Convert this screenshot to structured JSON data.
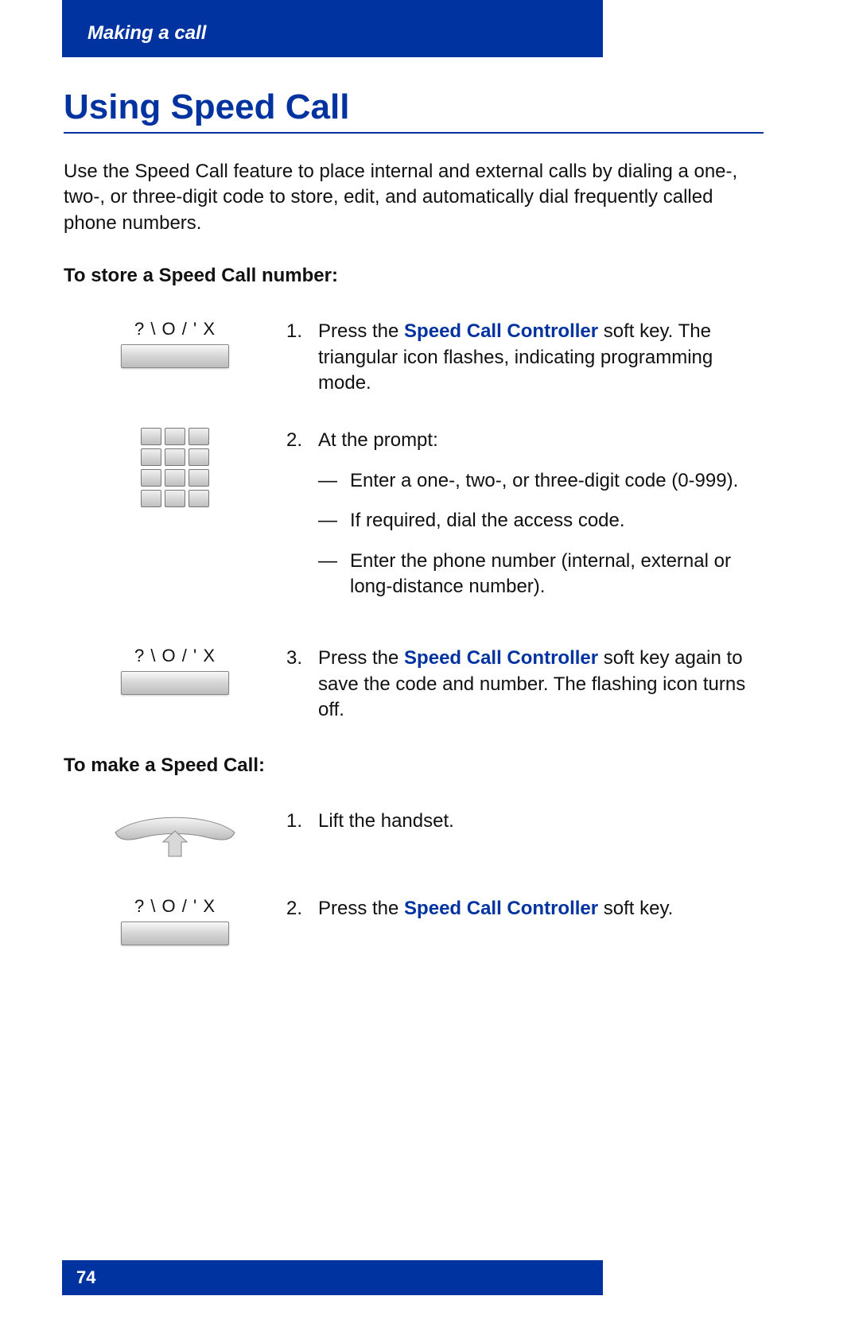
{
  "header": {
    "section": "Making a call"
  },
  "title": "Using Speed Call",
  "intro": "Use the Speed Call feature to place internal and external calls by dialing a one-, two-, or three-digit code to store, edit, and automatically dial frequently called phone numbers.",
  "section1": {
    "heading": "To store a Speed Call number:",
    "steps": {
      "s1": {
        "icon_label": "? \\ O / ' X",
        "num": "1.",
        "prefix": "Press the ",
        "bold": "Speed Call Controller",
        "suffix": " soft key. The triangular icon flashes, indicating programming mode."
      },
      "s2": {
        "num": "2.",
        "lead": "At the prompt:",
        "a": "Enter a one-, two-, or three-digit code (0-999).",
        "b": "If required, dial the access code.",
        "c": "Enter the phone number (internal, external or long-distance number)."
      },
      "s3": {
        "icon_label": "? \\ O / ' X",
        "num": "3.",
        "prefix": "Press the ",
        "bold": "Speed Call Controller",
        "suffix": " soft key again to save the code and number. The flashing icon turns off."
      }
    }
  },
  "section2": {
    "heading": "To make a Speed Call:",
    "steps": {
      "s1": {
        "num": "1.",
        "text": "Lift the handset."
      },
      "s2": {
        "icon_label": "? \\ O / ' X",
        "num": "2.",
        "prefix": "Press the ",
        "bold": "Speed Call Controller",
        "suffix": " soft key."
      }
    }
  },
  "footer": {
    "page": "74"
  },
  "dash": "—"
}
